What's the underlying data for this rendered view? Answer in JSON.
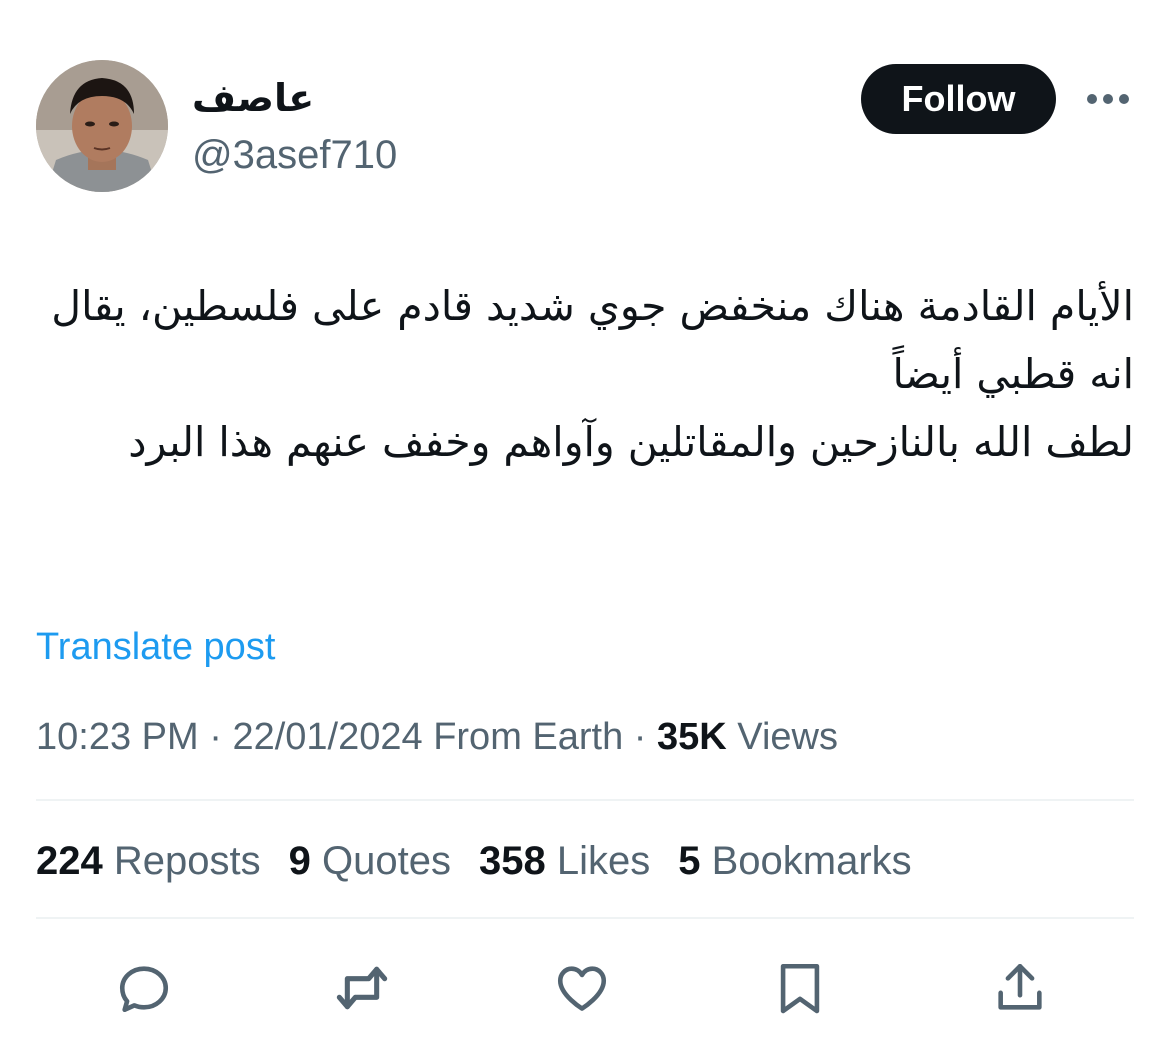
{
  "author": {
    "display_name": "عاصف",
    "handle": "@3asef710"
  },
  "follow_label": "Follow",
  "tweet": {
    "text": "الأيام القادمة هناك منخفض جوي شديد قادم على فلسطين، يقال انه قطبي أيضاً\nلطف الله بالنازحين والمقاتلين وآواهم وخفف عنهم هذا البرد"
  },
  "translate_label": "Translate post",
  "meta": {
    "time": "10:23 PM",
    "date": "22/01/2024",
    "source": "From Earth",
    "views_count": "35K",
    "views_label": "Views"
  },
  "stats": {
    "reposts_count": "224",
    "reposts_label": "Reposts",
    "quotes_count": "9",
    "quotes_label": "Quotes",
    "likes_count": "358",
    "likes_label": "Likes",
    "bookmarks_count": "5",
    "bookmarks_label": "Bookmarks"
  },
  "actions": [
    "reply-icon",
    "repost-icon",
    "like-icon",
    "bookmark-icon",
    "share-icon"
  ],
  "colors": {
    "text_primary": "#0f1419",
    "text_secondary": "#536471",
    "link": "#1d9bf0",
    "divider": "#eff3f4"
  }
}
